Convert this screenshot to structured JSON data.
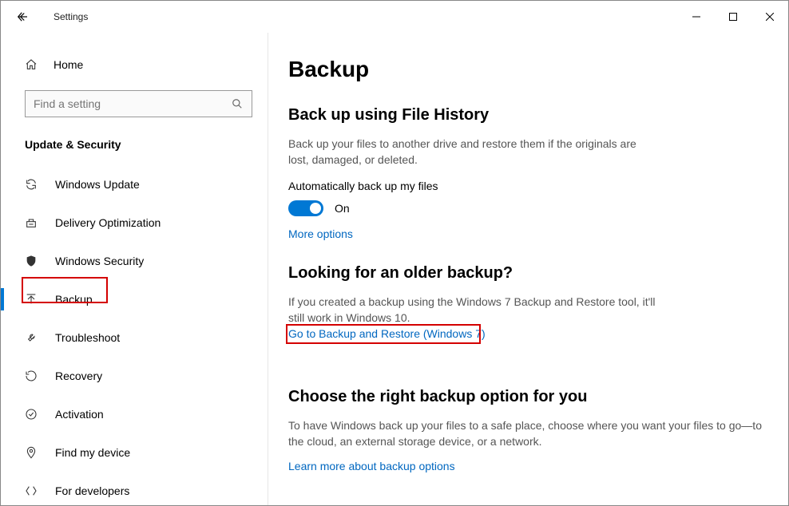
{
  "window": {
    "title": "Settings"
  },
  "sidebar": {
    "home_label": "Home",
    "search_placeholder": "Find a setting",
    "section_title": "Update & Security",
    "items": [
      {
        "id": "windows-update",
        "label": "Windows Update"
      },
      {
        "id": "delivery-optimization",
        "label": "Delivery Optimization"
      },
      {
        "id": "windows-security",
        "label": "Windows Security"
      },
      {
        "id": "backup",
        "label": "Backup"
      },
      {
        "id": "troubleshoot",
        "label": "Troubleshoot"
      },
      {
        "id": "recovery",
        "label": "Recovery"
      },
      {
        "id": "activation",
        "label": "Activation"
      },
      {
        "id": "find-my-device",
        "label": "Find my device"
      },
      {
        "id": "for-developers",
        "label": "For developers"
      }
    ]
  },
  "main": {
    "page_title": "Backup",
    "section1": {
      "heading": "Back up using File History",
      "desc": "Back up your files to another drive and restore them if the originals are lost, damaged, or deleted.",
      "toggle_label": "Automatically back up my files",
      "toggle_state": "On",
      "more_options": "More options"
    },
    "section2": {
      "heading": "Looking for an older backup?",
      "desc": "If you created a backup using the Windows 7 Backup and Restore tool, it'll still work in Windows 10.",
      "link": "Go to Backup and Restore (Windows 7)"
    },
    "section3": {
      "heading": "Choose the right backup option for you",
      "desc": "To have Windows back up your files to a safe place, choose where you want your files to go—to the cloud, an external storage device, or a network.",
      "link": "Learn more about backup options"
    }
  },
  "colors": {
    "accent": "#0078d4",
    "link": "#0067c0",
    "highlight": "#d40000"
  }
}
